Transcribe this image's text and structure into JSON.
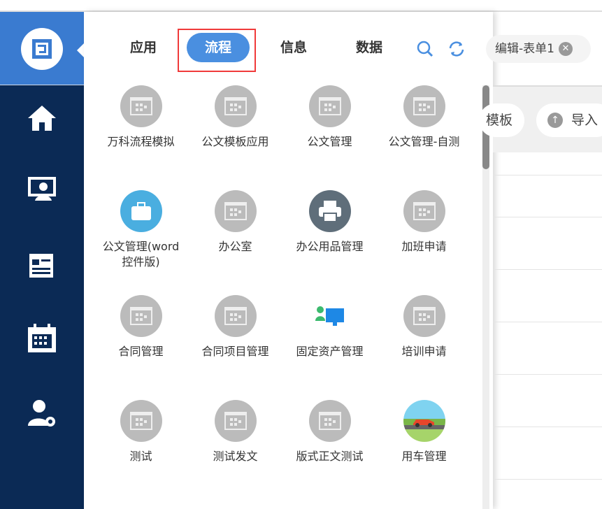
{
  "tabs": [
    "应用",
    "流程",
    "信息",
    "数据"
  ],
  "active_tab": "流程",
  "items": [
    {
      "label": "万科流程模拟",
      "icon": "flow-app-icon"
    },
    {
      "label": "公文模板应用",
      "icon": "flow-app-icon"
    },
    {
      "label": "公文管理",
      "icon": "flow-app-icon"
    },
    {
      "label": "公文管理-自测",
      "icon": "flow-app-icon"
    },
    {
      "label": "公文管理(word控件版)",
      "icon": "briefcase-icon"
    },
    {
      "label": "办公室",
      "icon": "flow-app-icon"
    },
    {
      "label": "办公用品管理",
      "icon": "printer-icon"
    },
    {
      "label": "加班申请",
      "icon": "flow-app-icon"
    },
    {
      "label": "合同管理",
      "icon": "flow-app-icon"
    },
    {
      "label": "合同项目管理",
      "icon": "flow-app-icon"
    },
    {
      "label": "固定资产管理",
      "icon": "asset-icon"
    },
    {
      "label": "培训申请",
      "icon": "flow-app-icon"
    },
    {
      "label": "测试",
      "icon": "flow-app-icon"
    },
    {
      "label": "测试发文",
      "icon": "flow-app-icon"
    },
    {
      "label": "版式正文测试",
      "icon": "flow-app-icon"
    },
    {
      "label": "用车管理",
      "icon": "car-icon"
    }
  ],
  "right": {
    "tab_label": "编辑-表单1",
    "btn_template": "模板",
    "btn_import": "导入"
  },
  "colors": {
    "accent": "#4a8fe0",
    "sidebar": "#0b2a55",
    "logo_bg": "#3a7bd0",
    "highlight": "#f03a3a"
  }
}
